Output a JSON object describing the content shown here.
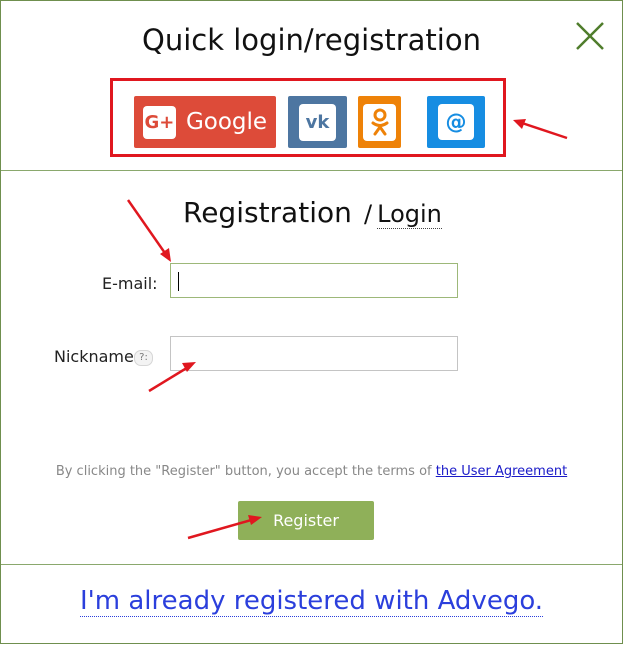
{
  "dialog": {
    "title": "Quick login/registration",
    "close_icon": "close-icon"
  },
  "social": {
    "google_icon_text": "G+",
    "google_label": "Google",
    "vk_icon_text": "vk",
    "ok_icon_text": "ok",
    "mail_icon_text": "@",
    "icons": [
      "google-plus-icon",
      "vk-icon",
      "odnoklassniki-icon",
      "mail-ru-icon"
    ],
    "colors": {
      "google": "#dd4b39",
      "vk": "#4d76a1",
      "ok": "#ee8208",
      "mail": "#168de2"
    }
  },
  "form": {
    "heading": "Registration",
    "separator": "/",
    "login_link": "Login",
    "email_label": "E-mail:",
    "email_value": "",
    "nickname_label": "Nickname",
    "nickname_help": "?:",
    "nickname_value": "",
    "terms_text": "By clicking the \"Register\" button, you accept the terms of",
    "terms_link": "the User Agreement",
    "register_label": "Register"
  },
  "footer": {
    "already_registered": "I'm already registered with Advego."
  },
  "annotations": {
    "arrow_color": "#e0171f"
  }
}
